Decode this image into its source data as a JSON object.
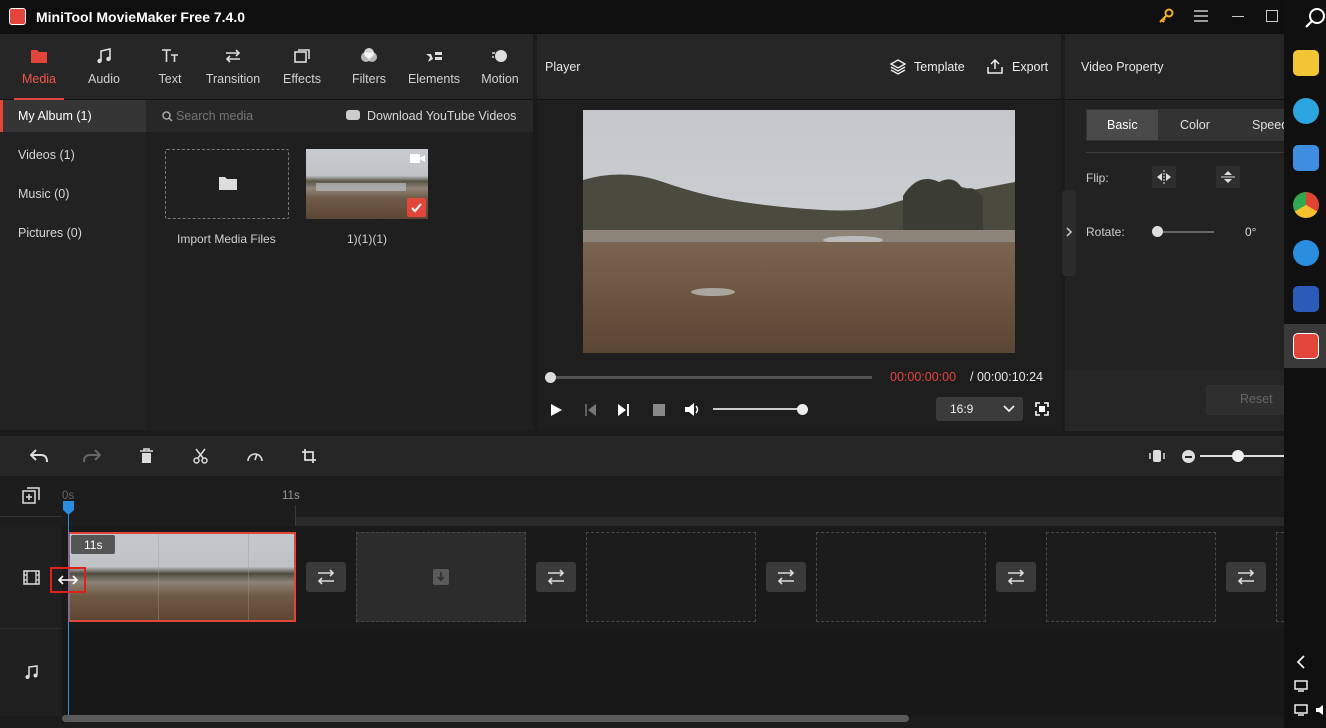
{
  "title_bar": {
    "app_title": "MiniTool MovieMaker Free 7.4.0"
  },
  "toolbar": {
    "tabs": [
      {
        "label": "Media",
        "icon": "folder-icon"
      },
      {
        "label": "Audio",
        "icon": "music-note-icon"
      },
      {
        "label": "Text",
        "icon": "text-icon"
      },
      {
        "label": "Transition",
        "icon": "transition-icon"
      },
      {
        "label": "Effects",
        "icon": "effects-icon"
      },
      {
        "label": "Filters",
        "icon": "filters-icon"
      },
      {
        "label": "Elements",
        "icon": "elements-icon"
      },
      {
        "label": "Motion",
        "icon": "motion-icon"
      }
    ]
  },
  "albums": [
    {
      "label": "My Album (1)"
    },
    {
      "label": "Videos (1)"
    },
    {
      "label": "Music (0)"
    },
    {
      "label": "Pictures (0)"
    }
  ],
  "media": {
    "search_placeholder": "Search media",
    "download_label": "Download YouTube Videos",
    "import_label": "Import Media Files",
    "clip_name": "1)(1)(1)"
  },
  "player": {
    "title": "Player",
    "template_label": "Template",
    "export_label": "Export",
    "current_time": "00:00:00:00",
    "total_time": "/ 00:00:10:24",
    "aspect_ratio": "16:9",
    "progress": 0,
    "volume": 0.95
  },
  "property": {
    "title": "Video Property",
    "tabs": [
      {
        "label": "Basic"
      },
      {
        "label": "Color"
      },
      {
        "label": "Speed"
      }
    ],
    "flip_label": "Flip:",
    "rotate_label": "Rotate:",
    "rotate_value": "0°",
    "reset_label": "Reset"
  },
  "timeline": {
    "ruler_start": "0s",
    "ruler_mark": "11s",
    "clip_duration": "11s"
  },
  "colors": {
    "accent": "#e2453a",
    "playhead": "#2b8de0",
    "time_current": "#e2453a"
  }
}
